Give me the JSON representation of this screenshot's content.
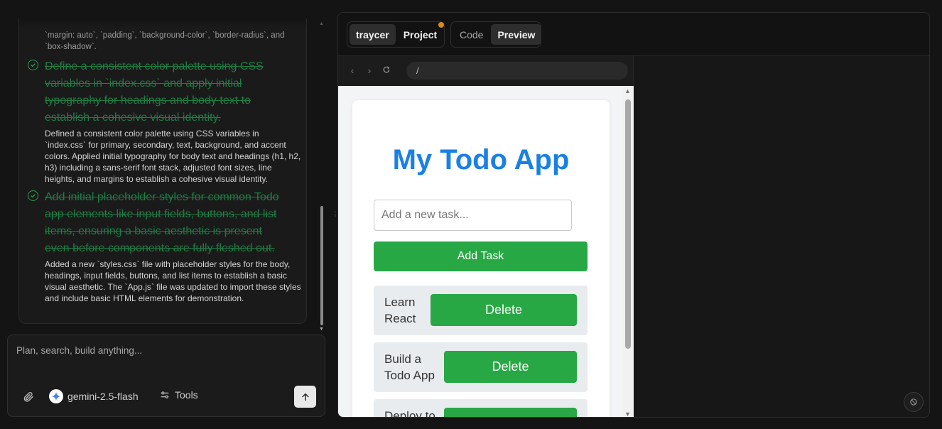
{
  "chat": {
    "top_text": "`margin: auto`, `padding`, `background-color`, `border-radius`, and `box-shadow`.",
    "tasks": [
      {
        "title": "Define a consistent color palette using CSS variables in `index.css` and apply initial typography for headings and body text to establish a cohesive visual identity.",
        "description": "Defined a consistent color palette using CSS variables in `index.css` for primary, secondary, text, background, and accent colors. Applied initial typography for body text and headings (h1, h2, h3) including a sans-serif font stack, adjusted font sizes, line heights, and margins to establish a cohesive visual identity."
      },
      {
        "title": "Add initial placeholder styles for common Todo app elements like input fields, buttons, and list items, ensuring a basic aesthetic is present even before components are fully fleshed out.",
        "description": "Added a new `styles.css` file with placeholder styles for the body, headings, input fields, buttons, and list items to establish a basic visual aesthetic. The `App.js` file was updated to import these styles and include basic HTML elements for demonstration."
      }
    ],
    "composer": {
      "placeholder": "Plan, search, build anything...",
      "model": "gemini-2.5-flash",
      "tools_label": "Tools"
    }
  },
  "preview": {
    "tabs_left": [
      "traycer",
      "Project"
    ],
    "tabs_right": [
      "Code",
      "Preview"
    ],
    "active_left": "traycer",
    "active_right": "Preview",
    "url": "/",
    "notification_color": "#d88a1a"
  },
  "app": {
    "title": "My Todo App",
    "input_placeholder": "Add a new task...",
    "add_button": "Add Task",
    "todos": [
      {
        "text": "Learn React",
        "button": "Delete"
      },
      {
        "text": "Build a Todo App",
        "button": "Delete"
      },
      {
        "text": "Deploy to",
        "button": ""
      }
    ],
    "accent_color": "#28a745",
    "title_color": "#1a80e6"
  }
}
